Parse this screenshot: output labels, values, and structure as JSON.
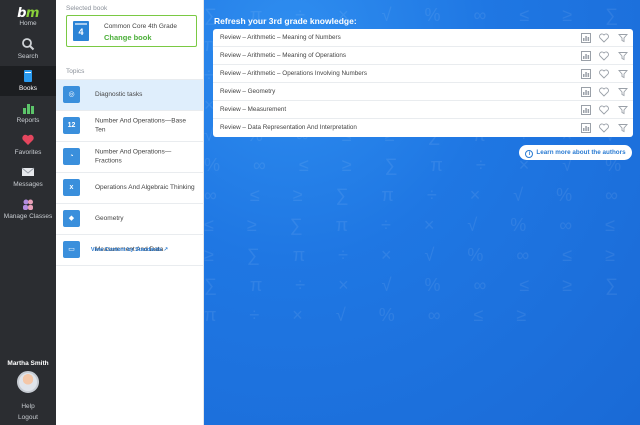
{
  "rail": {
    "logo_text": "bm",
    "home_label": "Home",
    "items": [
      {
        "label": "Search",
        "icon": "search-icon"
      },
      {
        "label": "Books",
        "icon": "book-icon"
      },
      {
        "label": "Reports",
        "icon": "bar-chart-icon"
      },
      {
        "label": "Favorites",
        "icon": "heart-icon"
      },
      {
        "label": "Messages",
        "icon": "envelope-icon"
      },
      {
        "label": "Manage Classes",
        "icon": "people-icon"
      }
    ],
    "active": "Books",
    "user_name": "Martha Smith",
    "help": "Help",
    "logout": "Logout"
  },
  "panel": {
    "selected_label": "Selected book",
    "book_number": "4",
    "book_title": "Common Core 4th Grade",
    "change_book": "Change book",
    "topics_label": "Topics",
    "topics": [
      {
        "label": "Diagnostic tasks",
        "icon": "globe-icon",
        "glyph": "◎"
      },
      {
        "label": "Number And Operations—Base Ten",
        "icon": "number-grid-icon",
        "glyph": "12"
      },
      {
        "label": "Number And Operations—Fractions",
        "icon": "pie-chart-icon",
        "glyph": "◔"
      },
      {
        "label": "Operations And Algebraic Thinking",
        "icon": "variable-icon",
        "glyph": "x"
      },
      {
        "label": "Geometry",
        "icon": "shapes-icon",
        "glyph": "◆"
      },
      {
        "label": "Measurement And Data",
        "icon": "ruler-icon",
        "glyph": "▭"
      }
    ],
    "active_topic": "Diagnostic tasks",
    "standards_link": "View Content by Standards ↗"
  },
  "main": {
    "heading": "Refresh your 3rd grade knowledge:",
    "reviews": [
      "Review – Arithmetic – Meaning of Numbers",
      "Review – Arithmetic – Meaning of Operations",
      "Review – Arithmetic – Operations Involving Numbers",
      "Review – Geometry",
      "Review – Measurement",
      "Review – Data Representation And Interpretation"
    ],
    "authors_button": "Learn more about the authors"
  },
  "colors": {
    "rail_bg": "#2b2d31",
    "accent_green": "#7ac943",
    "main_blue": "#1f77e3",
    "link_blue": "#2a7bd2",
    "active_topic_bg": "#dfeefc"
  }
}
